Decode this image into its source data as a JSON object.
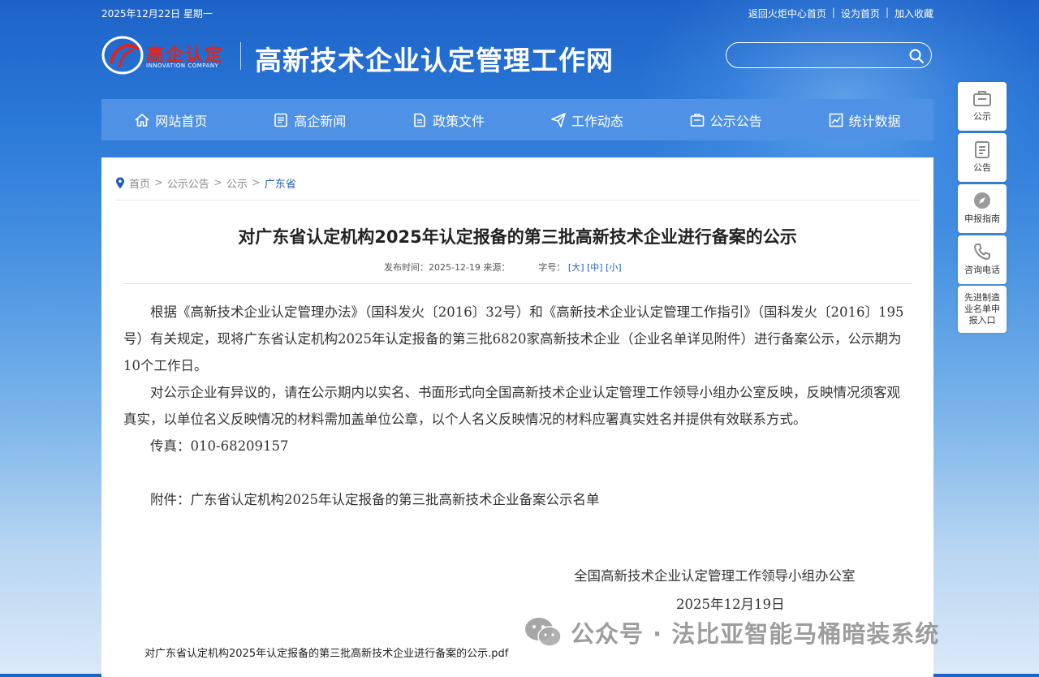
{
  "topbar": {
    "date": "2025年12月22日 星期一",
    "links": [
      "返回火炬中心首页",
      "设为首页",
      "加入收藏"
    ]
  },
  "logo": {
    "name": "高企认定",
    "sub": "INNOVATION COMPANY"
  },
  "site_title": "高新技术企业认定管理工作网",
  "search": {
    "placeholder": "",
    "value": ""
  },
  "nav": [
    {
      "label": "网站首页",
      "icon": "home-icon"
    },
    {
      "label": "高企新闻",
      "icon": "news-icon"
    },
    {
      "label": "政策文件",
      "icon": "document-icon"
    },
    {
      "label": "工作动态",
      "icon": "paper-plane-icon"
    },
    {
      "label": "公示公告",
      "icon": "notice-icon"
    },
    {
      "label": "统计数据",
      "icon": "chart-icon"
    }
  ],
  "breadcrumb": [
    "首页",
    "公示公告",
    "公示",
    "广东省"
  ],
  "article": {
    "title": "对广东省认定机构2025年认定报备的第三批高新技术企业进行备案的公示",
    "meta_date": "发布时间：2025-12-19 来源：",
    "meta_fontsize": "字号：",
    "font_large": "大",
    "font_medium": "中",
    "font_small": "小",
    "para1": "根据《高新技术企业认定管理办法》（国科发火〔2016〕32号）和《高新技术企业认定管理工作指引》（国科发火〔2016〕195号）有关规定，现将广东省认定机构2025年认定报备的第三批6820家高新技术企业（企业名单详见附件）进行备案公示，公示期为10个工作日。",
    "para2": "对公示企业有异议的，请在公示期内以实名、书面形式向全国高新技术企业认定管理工作领导小组办公室反映，反映情况须客观真实，以单位名义反映情况的材料需加盖单位公章，以个人名义反映情况的材料应署真实姓名并提供有效联系方式。",
    "fax": "传真：010-68209157",
    "attachment": "附件：广东省认定机构2025年认定报备的第三批高新技术企业备案公示名单",
    "signer": "全国高新技术企业认定管理工作领导小组办公室",
    "sign_date": "2025年12月19日",
    "pdf_link": "对广东省认定机构2025年认定报备的第三批高新技术企业进行备案的公示.pdf"
  },
  "side_buttons": [
    {
      "label": "公示",
      "icon": "briefcase-icon"
    },
    {
      "label": "公告",
      "icon": "clipboard-icon"
    },
    {
      "label": "申报指南",
      "icon": "compass-icon"
    },
    {
      "label": "咨询电话",
      "icon": "phone-icon"
    },
    {
      "label": "先进制造业名单申报入口",
      "icon": ""
    }
  ],
  "watermark": "公众号 · 法比亚智能马桶暗装系统",
  "colors": {
    "nav": "#4f91e4",
    "accent": "#1f5fb8",
    "logo_red": "#e2231a"
  }
}
